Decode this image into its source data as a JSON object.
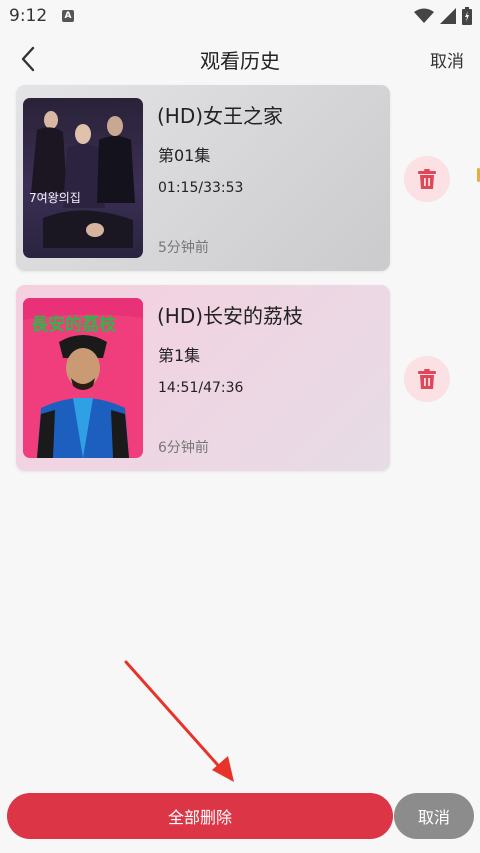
{
  "status_bar": {
    "time": "9:12",
    "notification_icon_letter": "A",
    "icons": [
      "wifi-icon",
      "cell-signal-icon",
      "battery-icon"
    ]
  },
  "header": {
    "title": "观看历史",
    "cancel_label": "取消"
  },
  "history": [
    {
      "title": "(HD)女王之家",
      "episode": "第01集",
      "progress": "01:15/33:53",
      "time_ago": "5分钟前",
      "poster_text": "7여왕의집"
    },
    {
      "title": "(HD)长安的荔枝",
      "episode": "第1集",
      "progress": "14:51/47:36",
      "time_ago": "6分钟前",
      "poster_text": "長安的荔枝"
    }
  ],
  "bottom_bar": {
    "delete_all_label": "全部删除",
    "cancel_label": "取消"
  },
  "colors": {
    "accent_red": "#dc3545",
    "delete_icon": "#e0485a",
    "delete_bg": "#fbe0e4",
    "cancel_gray": "#8c8c8c",
    "arrow_red": "#e8332b"
  }
}
